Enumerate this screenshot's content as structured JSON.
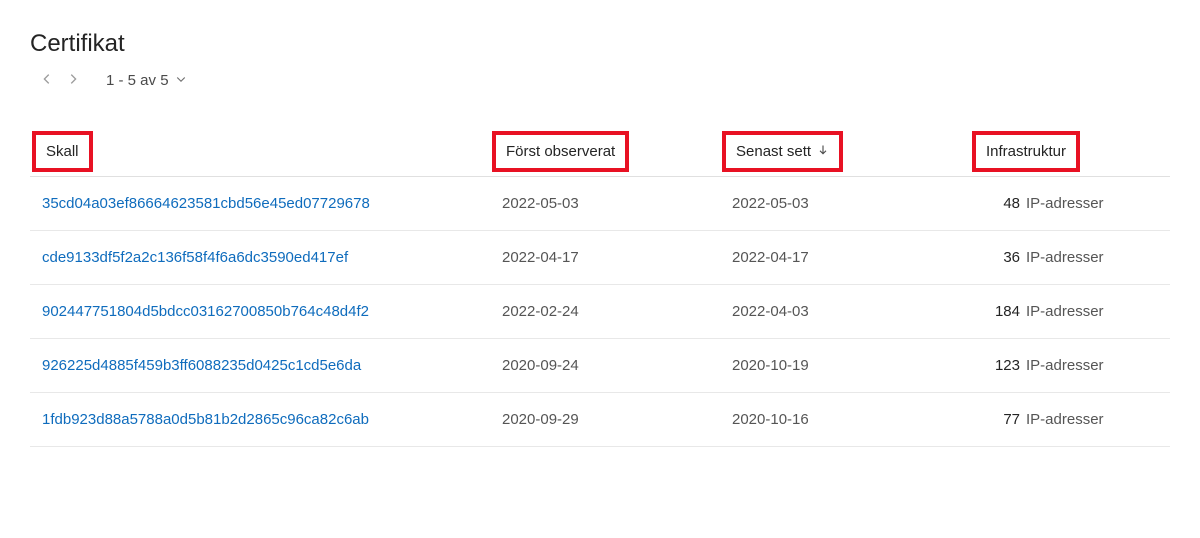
{
  "title": "Certifikat",
  "pager": {
    "range": "1 - 5 av 5"
  },
  "headers": {
    "shall": "Skall",
    "first_observed": "Först observerat",
    "last_seen": "Senast sett",
    "infrastructure": "Infrastruktur"
  },
  "infra_unit": "IP-adresser",
  "rows": [
    {
      "shall": "35cd04a03ef86664623581cbd56e45ed07729678",
      "first": "2022-05-03",
      "last": "2022-05-03",
      "count": "48"
    },
    {
      "shall": "cde9133df5f2a2c136f58f4f6a6dc3590ed417ef",
      "first": "2022-04-17",
      "last": "2022-04-17",
      "count": "36"
    },
    {
      "shall": "902447751804d5bdcc03162700850b764c48d4f2",
      "first": "2022-02-24",
      "last": "2022-04-03",
      "count": "184"
    },
    {
      "shall": "926225d4885f459b3ff6088235d0425c1cd5e6da",
      "first": "2020-09-24",
      "last": "2020-10-19",
      "count": "123"
    },
    {
      "shall": "1fdb923d88a5788a0d5b81b2d2865c96ca82c6ab",
      "first": "2020-09-29",
      "last": "2020-10-16",
      "count": "77"
    }
  ]
}
